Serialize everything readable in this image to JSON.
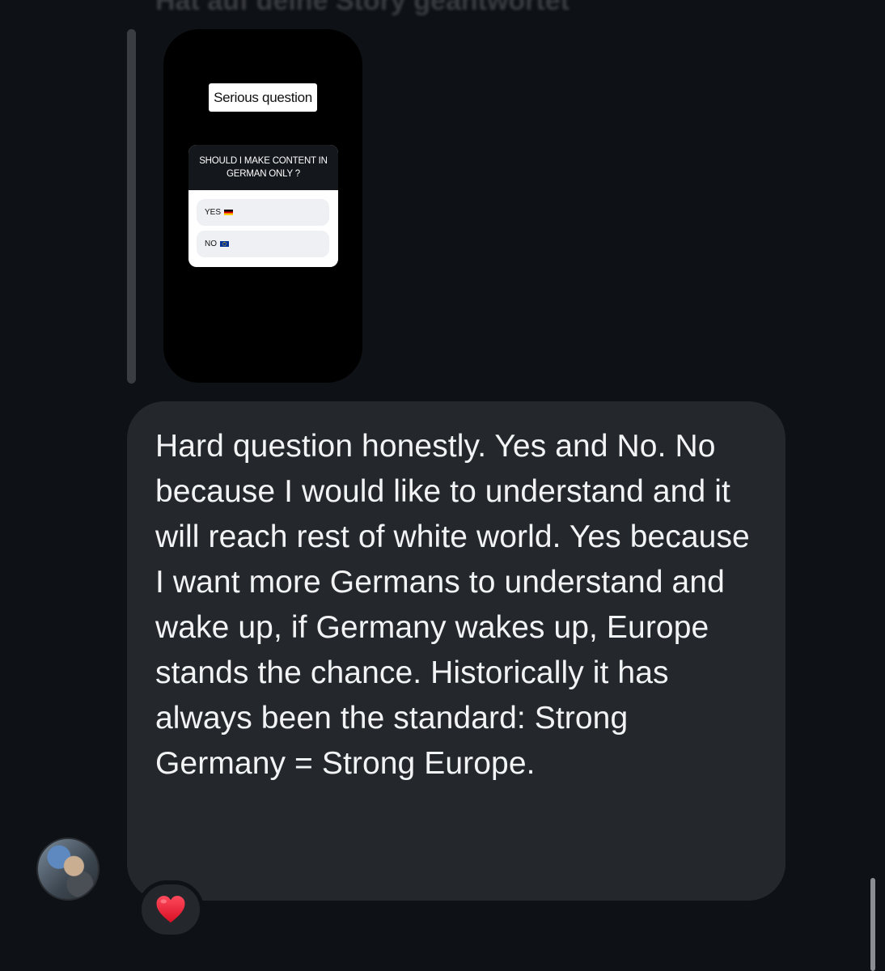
{
  "reply_context": {
    "header_text": "Hat auf deine Story geantwortet"
  },
  "story": {
    "title": "Serious question",
    "poll": {
      "question_line1": "SHOULD I MAKE CONTENT IN",
      "question_line2": "GERMAN ONLY ?",
      "options": [
        {
          "label": "YES",
          "flag": "germany-flag"
        },
        {
          "label": "NO",
          "flag": "eu-flag"
        }
      ]
    }
  },
  "message": {
    "text": "Hard question honestly. Yes and No. No because I would like to understand and it will reach rest of white world. Yes because I want more Germans to understand and wake up, if Germany wakes up, Europe stands the chance. Historically it has always been the standard: Strong Germany = Strong Europe."
  },
  "reaction": {
    "emoji_name": "red-heart-icon",
    "color": "#e8112d"
  },
  "colors": {
    "background": "#0e1115",
    "bubble": "#24272c",
    "text": "#f2f3f5"
  }
}
